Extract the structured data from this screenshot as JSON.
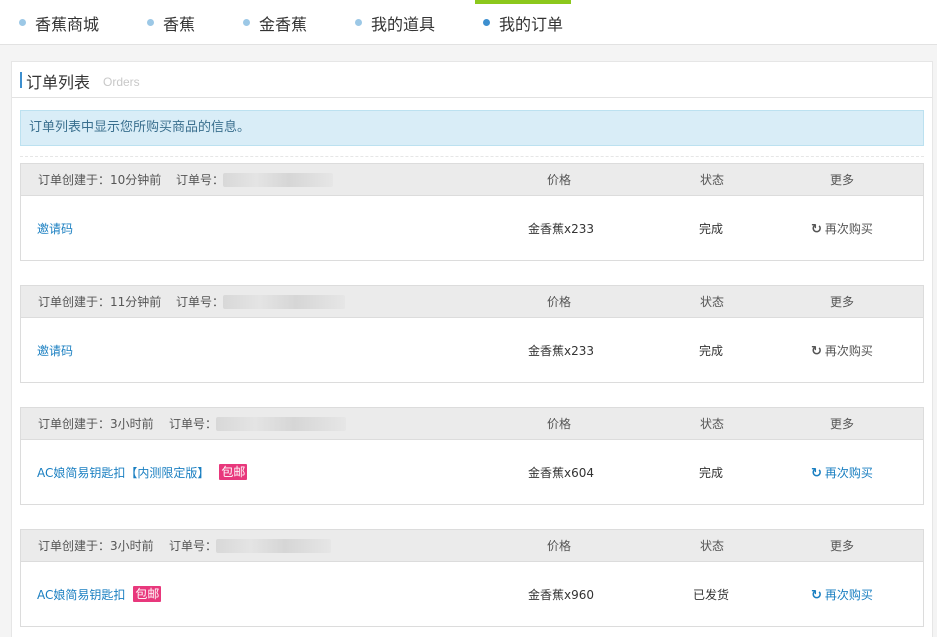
{
  "nav": {
    "tabs": [
      {
        "label": "香蕉商城",
        "active": false
      },
      {
        "label": "香蕉",
        "active": false
      },
      {
        "label": "金香蕉",
        "active": false
      },
      {
        "label": "我的道具",
        "active": false
      },
      {
        "label": "我的订单",
        "active": true
      }
    ]
  },
  "panel": {
    "title": "订单列表",
    "subtitle": "Orders",
    "notice": "订单列表中显示您所购买商品的信息。"
  },
  "columns": {
    "price": "价格",
    "status": "状态",
    "more": "更多"
  },
  "orders": [
    {
      "created": "订单创建于：10分钟前",
      "order_no_label": "订单号：",
      "item": "邀请码",
      "tag": "",
      "price": "金香蕉x233",
      "status": "完成",
      "action": "再次购买"
    },
    {
      "created": "订单创建于：11分钟前",
      "order_no_label": "订单号：",
      "item": "邀请码",
      "tag": "",
      "price": "金香蕉x233",
      "status": "完成",
      "action": "再次购买"
    },
    {
      "created": "订单创建于：3小时前",
      "order_no_label": "订单号：",
      "item": "AC娘简易钥匙扣【内测限定版】",
      "tag": "包邮",
      "price": "金香蕉x604",
      "status": "完成",
      "action": "再次购买"
    },
    {
      "created": "订单创建于：3小时前",
      "order_no_label": "订单号：",
      "item": "AC娘简易钥匙扣",
      "tag": "包邮",
      "price": "金香蕉x960",
      "status": "已发货",
      "action": "再次购买"
    }
  ],
  "icons": {
    "rebuy": "refresh-icon"
  }
}
